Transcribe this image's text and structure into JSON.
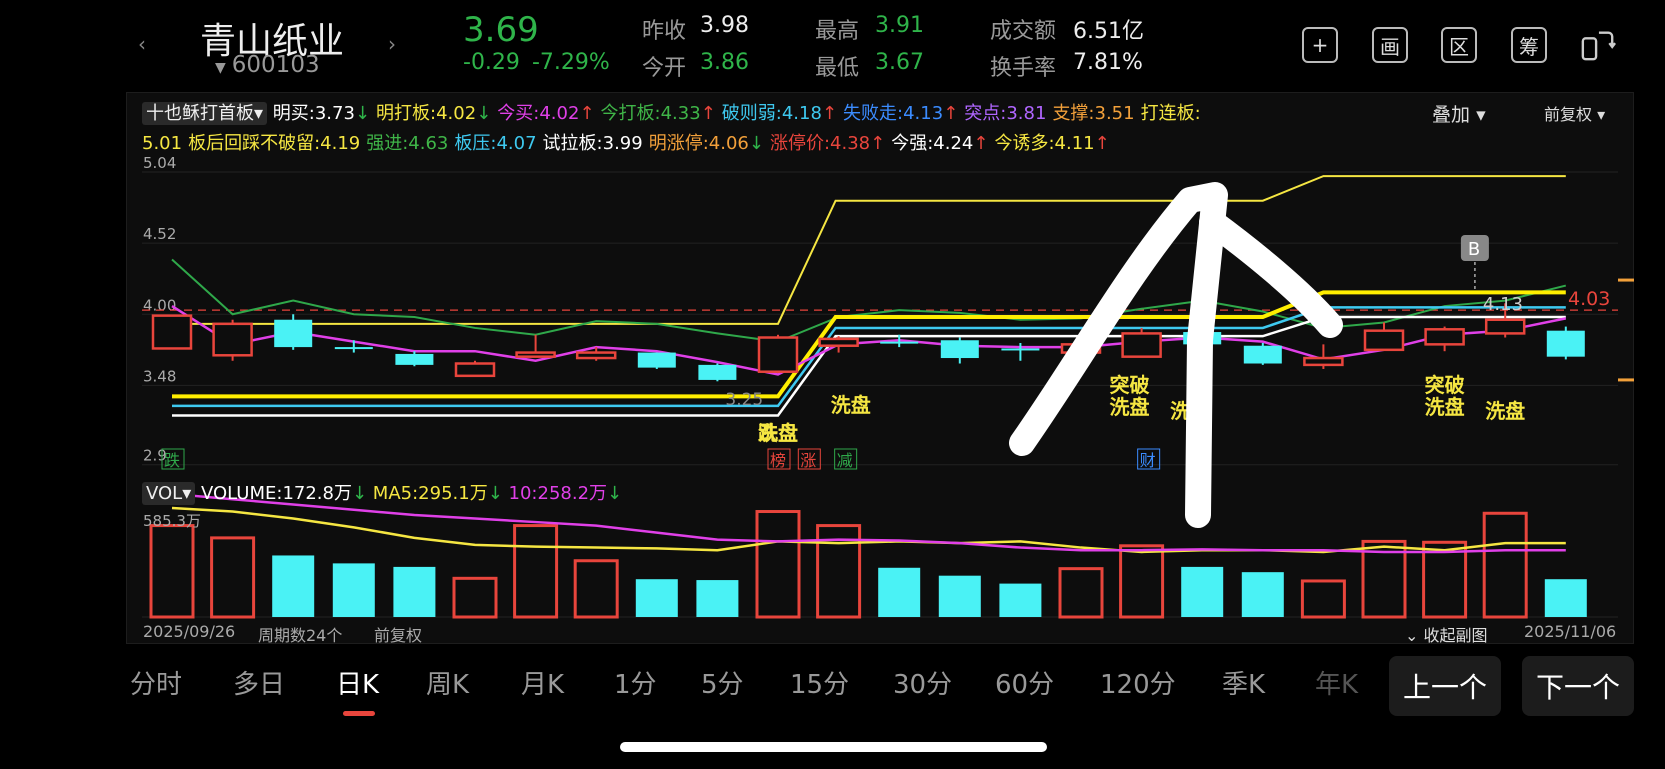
{
  "header": {
    "stock_name": "青山纸业",
    "stock_code": "600103",
    "price": "3.69",
    "change": "-0.29",
    "change_pct": "-7.29%",
    "stats": {
      "prev_close_label": "昨收",
      "prev_close": "3.98",
      "open_label": "今开",
      "open": "3.86",
      "high_label": "最高",
      "high": "3.91",
      "low_label": "最低",
      "low": "3.67",
      "amount_label": "成交额",
      "amount": "6.51亿",
      "turnover_label": "换手率",
      "turnover": "7.81%"
    },
    "tool_icons": [
      "plus-box-icon",
      "draw-icon",
      "range-icon",
      "chip-icon",
      "rotate-screen-icon"
    ],
    "tool_glyphs": [
      "+",
      "画",
      "区",
      "筹",
      "⇄"
    ]
  },
  "indicator": {
    "selector": "十也稣打首板",
    "items": [
      {
        "label": "明买:",
        "value": "3.73",
        "arrow": "↓",
        "color": "#ffffff"
      },
      {
        "label": "明打板:",
        "value": "4.02",
        "arrow": "↓",
        "color": "#f5e642"
      },
      {
        "label": "今买:",
        "value": "4.02",
        "arrow": "↑",
        "color": "#e040e8"
      },
      {
        "label": "今打板:",
        "value": "4.33",
        "arrow": "↑",
        "color": "#3fb548"
      },
      {
        "label": "破则弱:",
        "value": "4.18",
        "arrow": "↑",
        "color": "#3ec9f0"
      },
      {
        "label": "失败走:",
        "value": "4.13",
        "arrow": "↑",
        "color": "#3b8cff"
      },
      {
        "label": "突点:",
        "value": "3.81",
        "arrow": "",
        "color": "#b066ff"
      },
      {
        "label": "支撑:",
        "value": "3.51",
        "arrow": "",
        "color": "#f2a03a"
      },
      {
        "label": "打连板:",
        "value": "",
        "arrow": "",
        "color": "#f5e642"
      }
    ],
    "items2": [
      {
        "label": "",
        "value": "5.01",
        "arrow": "",
        "color": "#f5e642"
      },
      {
        "label": "板后回踩不破留:",
        "value": "4.19",
        "arrow": "",
        "color": "#f5e642"
      },
      {
        "label": "强进:",
        "value": "4.63",
        "arrow": "",
        "color": "#3fb548"
      },
      {
        "label": "板压:",
        "value": "4.07",
        "arrow": "",
        "color": "#3ec9f0"
      },
      {
        "label": "试拉板:",
        "value": "3.99",
        "arrow": "",
        "color": "#ffffff"
      },
      {
        "label": "明涨停:",
        "value": "4.06",
        "arrow": "↓",
        "color": "#f2a03a"
      },
      {
        "label": "涨停价:",
        "value": "4.38",
        "arrow": "↑",
        "color": "#e8453c"
      },
      {
        "label": "今强:",
        "value": "4.24",
        "arrow": "↑",
        "color": "#ffffff"
      },
      {
        "label": "今诱多:",
        "value": "4.11",
        "arrow": "↑",
        "color": "#f5e642"
      }
    ],
    "overlay": "叠加",
    "adjust": "前复权"
  },
  "chart_data": {
    "type": "candlestick",
    "y_ticks": [
      "5.04",
      "4.52",
      "4.00",
      "3.48",
      "2.9"
    ],
    "ylim": [
      2.92,
      5.04
    ],
    "ref_price": "4.03",
    "mark_b": "B",
    "mark_413": "4.13",
    "mark_325": "3.25",
    "candles": [
      {
        "o": 3.75,
        "c": 3.99,
        "h": 3.99,
        "l": 3.75
      },
      {
        "o": 3.7,
        "c": 3.93,
        "h": 3.96,
        "l": 3.66
      },
      {
        "o": 3.96,
        "c": 3.76,
        "h": 4.0,
        "l": 3.74
      },
      {
        "o": 3.76,
        "c": 3.75,
        "h": 3.81,
        "l": 3.72
      },
      {
        "o": 3.71,
        "c": 3.63,
        "h": 3.73,
        "l": 3.62
      },
      {
        "o": 3.55,
        "c": 3.64,
        "h": 3.66,
        "l": 3.55
      },
      {
        "o": 3.69,
        "c": 3.72,
        "h": 3.85,
        "l": 3.69
      },
      {
        "o": 3.68,
        "c": 3.72,
        "h": 3.76,
        "l": 3.66
      },
      {
        "o": 3.72,
        "c": 3.61,
        "h": 3.72,
        "l": 3.6
      },
      {
        "o": 3.63,
        "c": 3.52,
        "h": 3.64,
        "l": 3.51
      },
      {
        "o": 3.58,
        "c": 3.83,
        "h": 3.85,
        "l": 3.57
      },
      {
        "o": 3.77,
        "c": 3.82,
        "h": 3.84,
        "l": 3.72
      },
      {
        "o": 3.8,
        "c": 3.79,
        "h": 3.85,
        "l": 3.76
      },
      {
        "o": 3.81,
        "c": 3.68,
        "h": 3.83,
        "l": 3.64
      },
      {
        "o": 3.75,
        "c": 3.74,
        "h": 3.79,
        "l": 3.66
      },
      {
        "o": 3.72,
        "c": 3.78,
        "h": 3.81,
        "l": 3.7
      },
      {
        "o": 3.69,
        "c": 3.86,
        "h": 3.9,
        "l": 3.69
      },
      {
        "o": 3.87,
        "c": 3.78,
        "h": 3.87,
        "l": 3.74
      },
      {
        "o": 3.77,
        "c": 3.64,
        "h": 3.79,
        "l": 3.63
      },
      {
        "o": 3.63,
        "c": 3.68,
        "h": 3.78,
        "l": 3.6
      },
      {
        "o": 3.74,
        "c": 3.88,
        "h": 3.94,
        "l": 3.74
      },
      {
        "o": 3.78,
        "c": 3.89,
        "h": 3.91,
        "l": 3.73
      },
      {
        "o": 3.86,
        "c": 3.96,
        "h": 4.08,
        "l": 3.83
      },
      {
        "o": 3.88,
        "c": 3.69,
        "h": 3.91,
        "l": 3.67
      }
    ],
    "lines": [
      {
        "color": "#f5e642",
        "width": 2,
        "values": [
          3.93,
          3.93,
          3.93,
          3.93,
          3.93,
          3.93,
          3.93,
          3.93,
          3.93,
          3.93,
          4.83,
          4.83,
          4.83,
          4.83,
          4.83,
          4.83,
          4.83,
          4.83,
          4.83,
          5.01,
          5.01,
          5.01,
          5.01,
          5.01
        ]
      },
      {
        "color": "#2fa84a",
        "width": 2,
        "values": [
          4.4,
          4.0,
          4.1,
          4.0,
          3.98,
          3.9,
          3.85,
          3.95,
          3.93,
          3.86,
          3.8,
          3.98,
          4.03,
          4.01,
          3.96,
          3.97,
          4.04,
          4.1,
          4.02,
          3.9,
          3.94,
          4.06,
          4.1,
          4.21
        ]
      },
      {
        "color": "#ffee00",
        "width": 4,
        "values": [
          3.4,
          3.4,
          3.4,
          3.4,
          3.4,
          3.4,
          3.4,
          3.4,
          3.4,
          3.4,
          3.98,
          3.98,
          3.98,
          3.98,
          3.98,
          3.98,
          3.98,
          3.98,
          3.98,
          4.16,
          4.16,
          4.16,
          4.16,
          4.16
        ]
      },
      {
        "color": "#3ec9f0",
        "width": 2.5,
        "values": [
          3.33,
          3.33,
          3.33,
          3.33,
          3.33,
          3.33,
          3.33,
          3.33,
          3.33,
          3.33,
          3.9,
          3.9,
          3.9,
          3.9,
          3.9,
          3.9,
          3.9,
          3.9,
          3.9,
          4.05,
          4.05,
          4.05,
          4.05,
          4.05
        ]
      },
      {
        "color": "#ffffff",
        "width": 2.5,
        "values": [
          3.26,
          3.26,
          3.26,
          3.26,
          3.26,
          3.26,
          3.26,
          3.26,
          3.26,
          3.26,
          3.84,
          3.84,
          3.84,
          3.84,
          3.84,
          3.84,
          3.84,
          3.84,
          3.84,
          3.98,
          3.98,
          3.98,
          3.98,
          3.98
        ]
      },
      {
        "color": "#e040e8",
        "width": 2.5,
        "values": [
          4.06,
          3.78,
          3.87,
          3.8,
          3.73,
          3.73,
          3.66,
          3.76,
          3.73,
          3.65,
          3.56,
          3.78,
          3.81,
          3.77,
          3.76,
          3.76,
          3.8,
          3.83,
          3.8,
          3.67,
          3.74,
          3.85,
          3.88,
          3.97
        ]
      }
    ],
    "labels": [
      {
        "i": 10.3,
        "text": "跌",
        "color": "#2fa84a"
      },
      {
        "i": -0.2,
        "text": "跌",
        "color": "#2fa84a"
      }
    ],
    "annotations": [
      {
        "i": 10.0,
        "row": 0,
        "text": "跌盘",
        "color": "#f5e642"
      },
      {
        "i": 10.0,
        "row": 0,
        "text": "洗盘",
        "color": "#f5e642"
      },
      {
        "i": 11.2,
        "row": 1,
        "text": "洗盘",
        "color": "#f5e642"
      },
      {
        "i": 15.8,
        "row": 2,
        "text": "突破",
        "color": "#f5e642"
      },
      {
        "i": 15.8,
        "row": 3,
        "text": "洗盘",
        "color": "#f5e642"
      },
      {
        "i": 16.8,
        "row": 4,
        "text": "洗盘",
        "color": "#f5e642"
      },
      {
        "i": 21.0,
        "row": 2,
        "text": "突破",
        "color": "#f5e642"
      },
      {
        "i": 21.0,
        "row": 3,
        "text": "洗盘",
        "color": "#f5e642"
      },
      {
        "i": 22.0,
        "row": 4,
        "text": "洗盘",
        "color": "#f5e642"
      }
    ],
    "tags": [
      {
        "i": 10.0,
        "text": "榜",
        "color": "#e8453c"
      },
      {
        "i": 10.5,
        "text": "涨",
        "color": "#e8453c"
      },
      {
        "i": 11.1,
        "text": "减",
        "color": "#2fa84a"
      },
      {
        "i": 16.1,
        "text": "财",
        "color": "#3b8cff"
      },
      {
        "i": 0.0,
        "text": "跌",
        "color": "#2fa84a"
      }
    ]
  },
  "volume": {
    "selector": "VOL",
    "label": "VOLUME:",
    "value": "172.8万",
    "value_arrow": "↓",
    "ma5_label": "MA5:",
    "ma5": "295.1万",
    "ma5_arrow": "↓",
    "ma10_label": "10:",
    "ma10": "258.2万",
    "ma10_arrow": "↓",
    "max_label": "585.3万",
    "vmax": 585.3,
    "bars": [
      520,
      450,
      350,
      305,
      285,
      220,
      520,
      320,
      215,
      210,
      600,
      520,
      280,
      235,
      190,
      275,
      405,
      285,
      255,
      205,
      430,
      425,
      590,
      215
    ],
    "ma5_line": [
      620,
      600,
      560,
      510,
      450,
      410,
      400,
      395,
      390,
      380,
      430,
      420,
      430,
      420,
      430,
      395,
      370,
      380,
      380,
      370,
      400,
      380,
      420,
      420
    ],
    "ma10_line": [
      700,
      670,
      640,
      610,
      580,
      560,
      540,
      520,
      480,
      440,
      430,
      440,
      435,
      420,
      395,
      380,
      380,
      385,
      380,
      380,
      370,
      370,
      380,
      380
    ]
  },
  "footer": {
    "start_date": "2025/09/26",
    "period_count": "周期数24个",
    "adjust": "前复权",
    "collapse": "收起副图",
    "end_date": "2025/11/06"
  },
  "tabs": [
    "分时",
    "多日",
    "日K",
    "周K",
    "月K",
    "1分",
    "5分",
    "15分",
    "30分",
    "60分",
    "120分",
    "季K",
    "年K"
  ],
  "active_tab": 2,
  "prev_button": "上一个",
  "next_button": "下一个"
}
